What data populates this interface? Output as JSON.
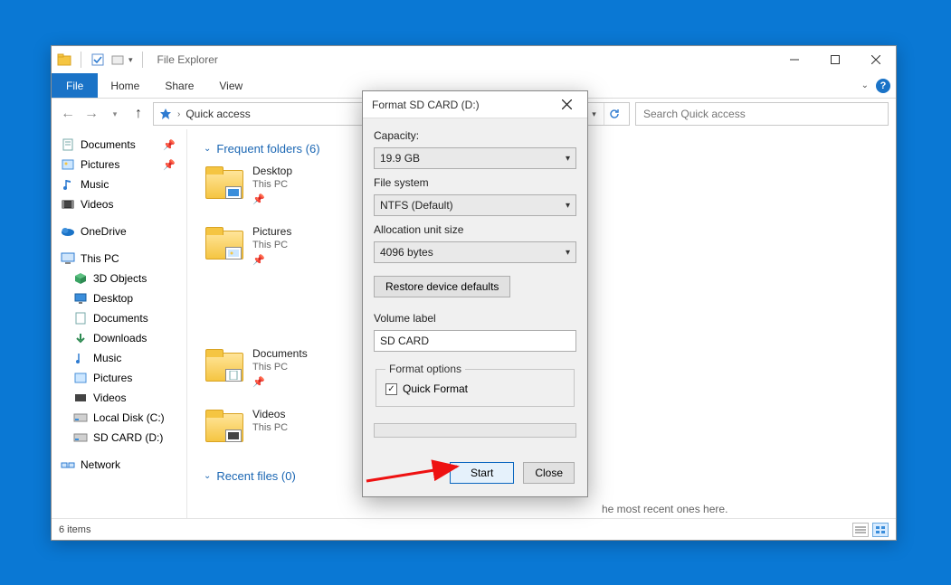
{
  "titlebar": {
    "app_title": "File Explorer"
  },
  "ribbon": {
    "file": "File",
    "tabs": [
      "Home",
      "Share",
      "View"
    ]
  },
  "address": {
    "crumb": "Quick access",
    "search_placeholder": "Search Quick access"
  },
  "nav": {
    "quick_access": [
      {
        "label": "Documents",
        "pinned": true,
        "icon": "doc"
      },
      {
        "label": "Pictures",
        "pinned": true,
        "icon": "pic"
      },
      {
        "label": "Music",
        "pinned": false,
        "icon": "music"
      },
      {
        "label": "Videos",
        "pinned": false,
        "icon": "video"
      }
    ],
    "onedrive": "OneDrive",
    "this_pc": "This PC",
    "this_pc_children": [
      {
        "label": "3D Objects",
        "icon": "cube"
      },
      {
        "label": "Desktop",
        "icon": "desk"
      },
      {
        "label": "Documents",
        "icon": "doc"
      },
      {
        "label": "Downloads",
        "icon": "down"
      },
      {
        "label": "Music",
        "icon": "music"
      },
      {
        "label": "Pictures",
        "icon": "pic"
      },
      {
        "label": "Videos",
        "icon": "video"
      },
      {
        "label": "Local Disk (C:)",
        "icon": "diskc"
      },
      {
        "label": "SD CARD (D:)",
        "icon": "diskd"
      }
    ],
    "network": "Network"
  },
  "content": {
    "frequent_header": "Frequent folders (6)",
    "recent_header": "Recent files (0)",
    "recent_empty_hint": "he most recent ones here.",
    "tiles": [
      {
        "title": "Desktop",
        "sub": "This PC",
        "pinned": true
      },
      {
        "title": "Pictures",
        "sub": "This PC",
        "pinned": true
      },
      {
        "title": "Documents",
        "sub": "This PC",
        "pinned": true
      },
      {
        "title": "Videos",
        "sub": "This PC",
        "pinned": false
      }
    ]
  },
  "status": {
    "items": "6 items"
  },
  "dialog": {
    "title": "Format SD CARD (D:)",
    "labels": {
      "capacity": "Capacity:",
      "filesystem": "File system",
      "alloc": "Allocation unit size",
      "restore": "Restore device defaults",
      "volume": "Volume label",
      "options_legend": "Format options",
      "quick_format": "Quick Format",
      "start": "Start",
      "close": "Close"
    },
    "values": {
      "capacity": "19.9 GB",
      "filesystem": "NTFS (Default)",
      "alloc": "4096 bytes",
      "volume": "SD CARD",
      "quick_format_checked": true
    }
  }
}
